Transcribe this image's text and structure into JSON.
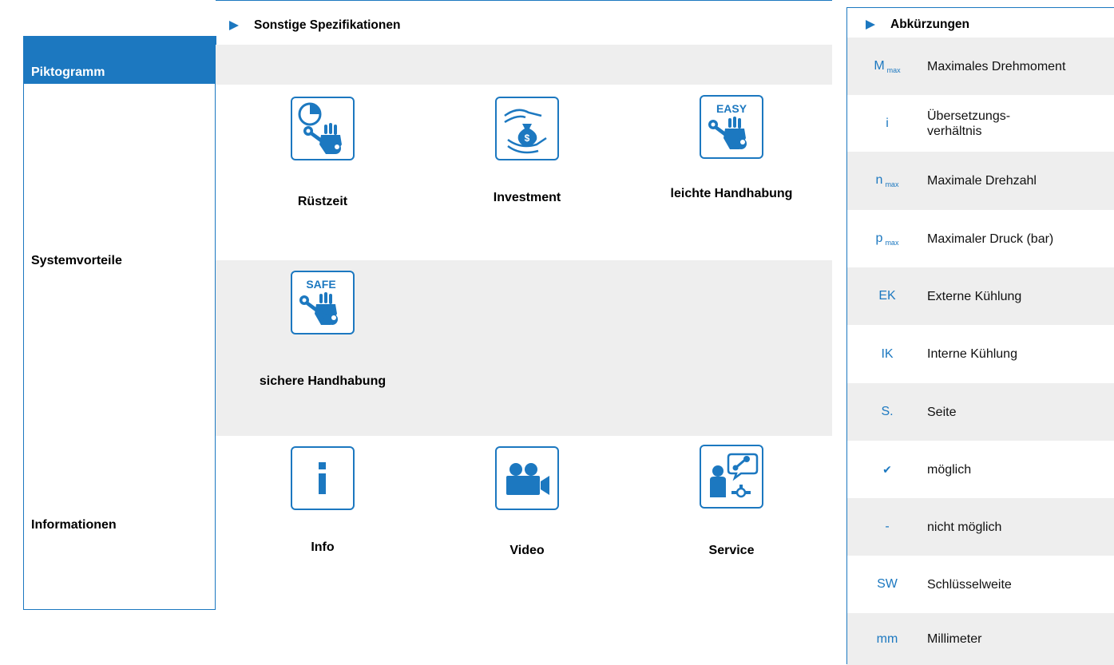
{
  "left": {
    "header": "Piktogramm",
    "row1": "Systemvorteile",
    "row2": "Informationen"
  },
  "center": {
    "title": "Sonstige Spezifikationen",
    "advantages": [
      {
        "label": "Rüstzeit",
        "icon": "setup-time-icon"
      },
      {
        "label": "Investment",
        "icon": "investment-icon"
      },
      {
        "label": "leichte Handhabung",
        "icon": "easy-handling-icon",
        "badge": "EASY"
      },
      {
        "label": "sichere Handhabung",
        "icon": "safe-handling-icon",
        "badge": "SAFE"
      }
    ],
    "info": [
      {
        "label": "Info",
        "icon": "info-icon"
      },
      {
        "label": "Video",
        "icon": "video-camera-icon"
      },
      {
        "label": "Service",
        "icon": "service-icon"
      }
    ]
  },
  "right": {
    "title": "Abkürzungen",
    "rows": [
      {
        "sym": "M",
        "sub": "max",
        "desc": "Maximales Drehmoment"
      },
      {
        "sym": "i",
        "sub": "",
        "desc": "Übersetzungs- verhältnis"
      },
      {
        "sym": "n",
        "sub": "max",
        "desc": "Maximale Drehzahl"
      },
      {
        "sym": "p",
        "sub": "max",
        "desc": "Maximaler Druck (bar)"
      },
      {
        "sym": "EK",
        "sub": "",
        "desc": "Externe Kühlung"
      },
      {
        "sym": "IK",
        "sub": "",
        "desc": "Interne Kühlung"
      },
      {
        "sym": "S.",
        "sub": "",
        "desc": "Seite"
      },
      {
        "sym": "✔",
        "sub": "",
        "desc": "möglich"
      },
      {
        "sym": "-",
        "sub": "",
        "desc": "nicht möglich"
      },
      {
        "sym": "SW",
        "sub": "",
        "desc": "Schlüsselweite"
      },
      {
        "sym": "mm",
        "sub": "",
        "desc": "Millimeter"
      }
    ]
  },
  "colors": {
    "accent": "#1c78c0",
    "gray": "#eeeeee"
  }
}
